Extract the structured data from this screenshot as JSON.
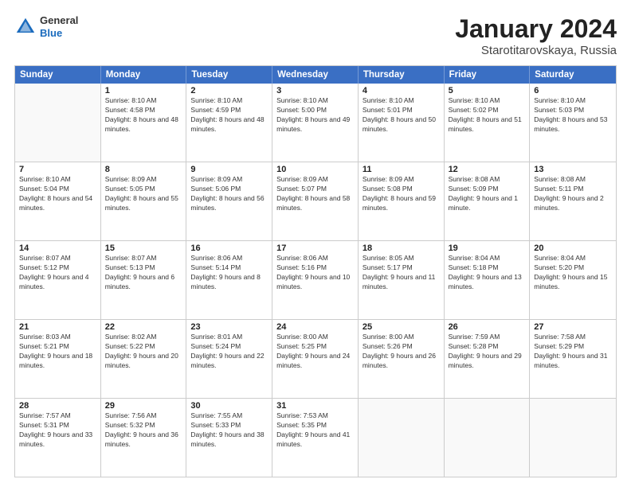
{
  "header": {
    "logo": {
      "general": "General",
      "blue": "Blue"
    },
    "title": "January 2024",
    "location": "Starotitarovskaya, Russia"
  },
  "weekdays": [
    "Sunday",
    "Monday",
    "Tuesday",
    "Wednesday",
    "Thursday",
    "Friday",
    "Saturday"
  ],
  "weeks": [
    [
      {
        "day": "",
        "sunrise": "",
        "sunset": "",
        "daylight": ""
      },
      {
        "day": "1",
        "sunrise": "Sunrise: 8:10 AM",
        "sunset": "Sunset: 4:58 PM",
        "daylight": "Daylight: 8 hours and 48 minutes."
      },
      {
        "day": "2",
        "sunrise": "Sunrise: 8:10 AM",
        "sunset": "Sunset: 4:59 PM",
        "daylight": "Daylight: 8 hours and 48 minutes."
      },
      {
        "day": "3",
        "sunrise": "Sunrise: 8:10 AM",
        "sunset": "Sunset: 5:00 PM",
        "daylight": "Daylight: 8 hours and 49 minutes."
      },
      {
        "day": "4",
        "sunrise": "Sunrise: 8:10 AM",
        "sunset": "Sunset: 5:01 PM",
        "daylight": "Daylight: 8 hours and 50 minutes."
      },
      {
        "day": "5",
        "sunrise": "Sunrise: 8:10 AM",
        "sunset": "Sunset: 5:02 PM",
        "daylight": "Daylight: 8 hours and 51 minutes."
      },
      {
        "day": "6",
        "sunrise": "Sunrise: 8:10 AM",
        "sunset": "Sunset: 5:03 PM",
        "daylight": "Daylight: 8 hours and 53 minutes."
      }
    ],
    [
      {
        "day": "7",
        "sunrise": "Sunrise: 8:10 AM",
        "sunset": "Sunset: 5:04 PM",
        "daylight": "Daylight: 8 hours and 54 minutes."
      },
      {
        "day": "8",
        "sunrise": "Sunrise: 8:09 AM",
        "sunset": "Sunset: 5:05 PM",
        "daylight": "Daylight: 8 hours and 55 minutes."
      },
      {
        "day": "9",
        "sunrise": "Sunrise: 8:09 AM",
        "sunset": "Sunset: 5:06 PM",
        "daylight": "Daylight: 8 hours and 56 minutes."
      },
      {
        "day": "10",
        "sunrise": "Sunrise: 8:09 AM",
        "sunset": "Sunset: 5:07 PM",
        "daylight": "Daylight: 8 hours and 58 minutes."
      },
      {
        "day": "11",
        "sunrise": "Sunrise: 8:09 AM",
        "sunset": "Sunset: 5:08 PM",
        "daylight": "Daylight: 8 hours and 59 minutes."
      },
      {
        "day": "12",
        "sunrise": "Sunrise: 8:08 AM",
        "sunset": "Sunset: 5:09 PM",
        "daylight": "Daylight: 9 hours and 1 minute."
      },
      {
        "day": "13",
        "sunrise": "Sunrise: 8:08 AM",
        "sunset": "Sunset: 5:11 PM",
        "daylight": "Daylight: 9 hours and 2 minutes."
      }
    ],
    [
      {
        "day": "14",
        "sunrise": "Sunrise: 8:07 AM",
        "sunset": "Sunset: 5:12 PM",
        "daylight": "Daylight: 9 hours and 4 minutes."
      },
      {
        "day": "15",
        "sunrise": "Sunrise: 8:07 AM",
        "sunset": "Sunset: 5:13 PM",
        "daylight": "Daylight: 9 hours and 6 minutes."
      },
      {
        "day": "16",
        "sunrise": "Sunrise: 8:06 AM",
        "sunset": "Sunset: 5:14 PM",
        "daylight": "Daylight: 9 hours and 8 minutes."
      },
      {
        "day": "17",
        "sunrise": "Sunrise: 8:06 AM",
        "sunset": "Sunset: 5:16 PM",
        "daylight": "Daylight: 9 hours and 10 minutes."
      },
      {
        "day": "18",
        "sunrise": "Sunrise: 8:05 AM",
        "sunset": "Sunset: 5:17 PM",
        "daylight": "Daylight: 9 hours and 11 minutes."
      },
      {
        "day": "19",
        "sunrise": "Sunrise: 8:04 AM",
        "sunset": "Sunset: 5:18 PM",
        "daylight": "Daylight: 9 hours and 13 minutes."
      },
      {
        "day": "20",
        "sunrise": "Sunrise: 8:04 AM",
        "sunset": "Sunset: 5:20 PM",
        "daylight": "Daylight: 9 hours and 15 minutes."
      }
    ],
    [
      {
        "day": "21",
        "sunrise": "Sunrise: 8:03 AM",
        "sunset": "Sunset: 5:21 PM",
        "daylight": "Daylight: 9 hours and 18 minutes."
      },
      {
        "day": "22",
        "sunrise": "Sunrise: 8:02 AM",
        "sunset": "Sunset: 5:22 PM",
        "daylight": "Daylight: 9 hours and 20 minutes."
      },
      {
        "day": "23",
        "sunrise": "Sunrise: 8:01 AM",
        "sunset": "Sunset: 5:24 PM",
        "daylight": "Daylight: 9 hours and 22 minutes."
      },
      {
        "day": "24",
        "sunrise": "Sunrise: 8:00 AM",
        "sunset": "Sunset: 5:25 PM",
        "daylight": "Daylight: 9 hours and 24 minutes."
      },
      {
        "day": "25",
        "sunrise": "Sunrise: 8:00 AM",
        "sunset": "Sunset: 5:26 PM",
        "daylight": "Daylight: 9 hours and 26 minutes."
      },
      {
        "day": "26",
        "sunrise": "Sunrise: 7:59 AM",
        "sunset": "Sunset: 5:28 PM",
        "daylight": "Daylight: 9 hours and 29 minutes."
      },
      {
        "day": "27",
        "sunrise": "Sunrise: 7:58 AM",
        "sunset": "Sunset: 5:29 PM",
        "daylight": "Daylight: 9 hours and 31 minutes."
      }
    ],
    [
      {
        "day": "28",
        "sunrise": "Sunrise: 7:57 AM",
        "sunset": "Sunset: 5:31 PM",
        "daylight": "Daylight: 9 hours and 33 minutes."
      },
      {
        "day": "29",
        "sunrise": "Sunrise: 7:56 AM",
        "sunset": "Sunset: 5:32 PM",
        "daylight": "Daylight: 9 hours and 36 minutes."
      },
      {
        "day": "30",
        "sunrise": "Sunrise: 7:55 AM",
        "sunset": "Sunset: 5:33 PM",
        "daylight": "Daylight: 9 hours and 38 minutes."
      },
      {
        "day": "31",
        "sunrise": "Sunrise: 7:53 AM",
        "sunset": "Sunset: 5:35 PM",
        "daylight": "Daylight: 9 hours and 41 minutes."
      },
      {
        "day": "",
        "sunrise": "",
        "sunset": "",
        "daylight": ""
      },
      {
        "day": "",
        "sunrise": "",
        "sunset": "",
        "daylight": ""
      },
      {
        "day": "",
        "sunrise": "",
        "sunset": "",
        "daylight": ""
      }
    ]
  ]
}
